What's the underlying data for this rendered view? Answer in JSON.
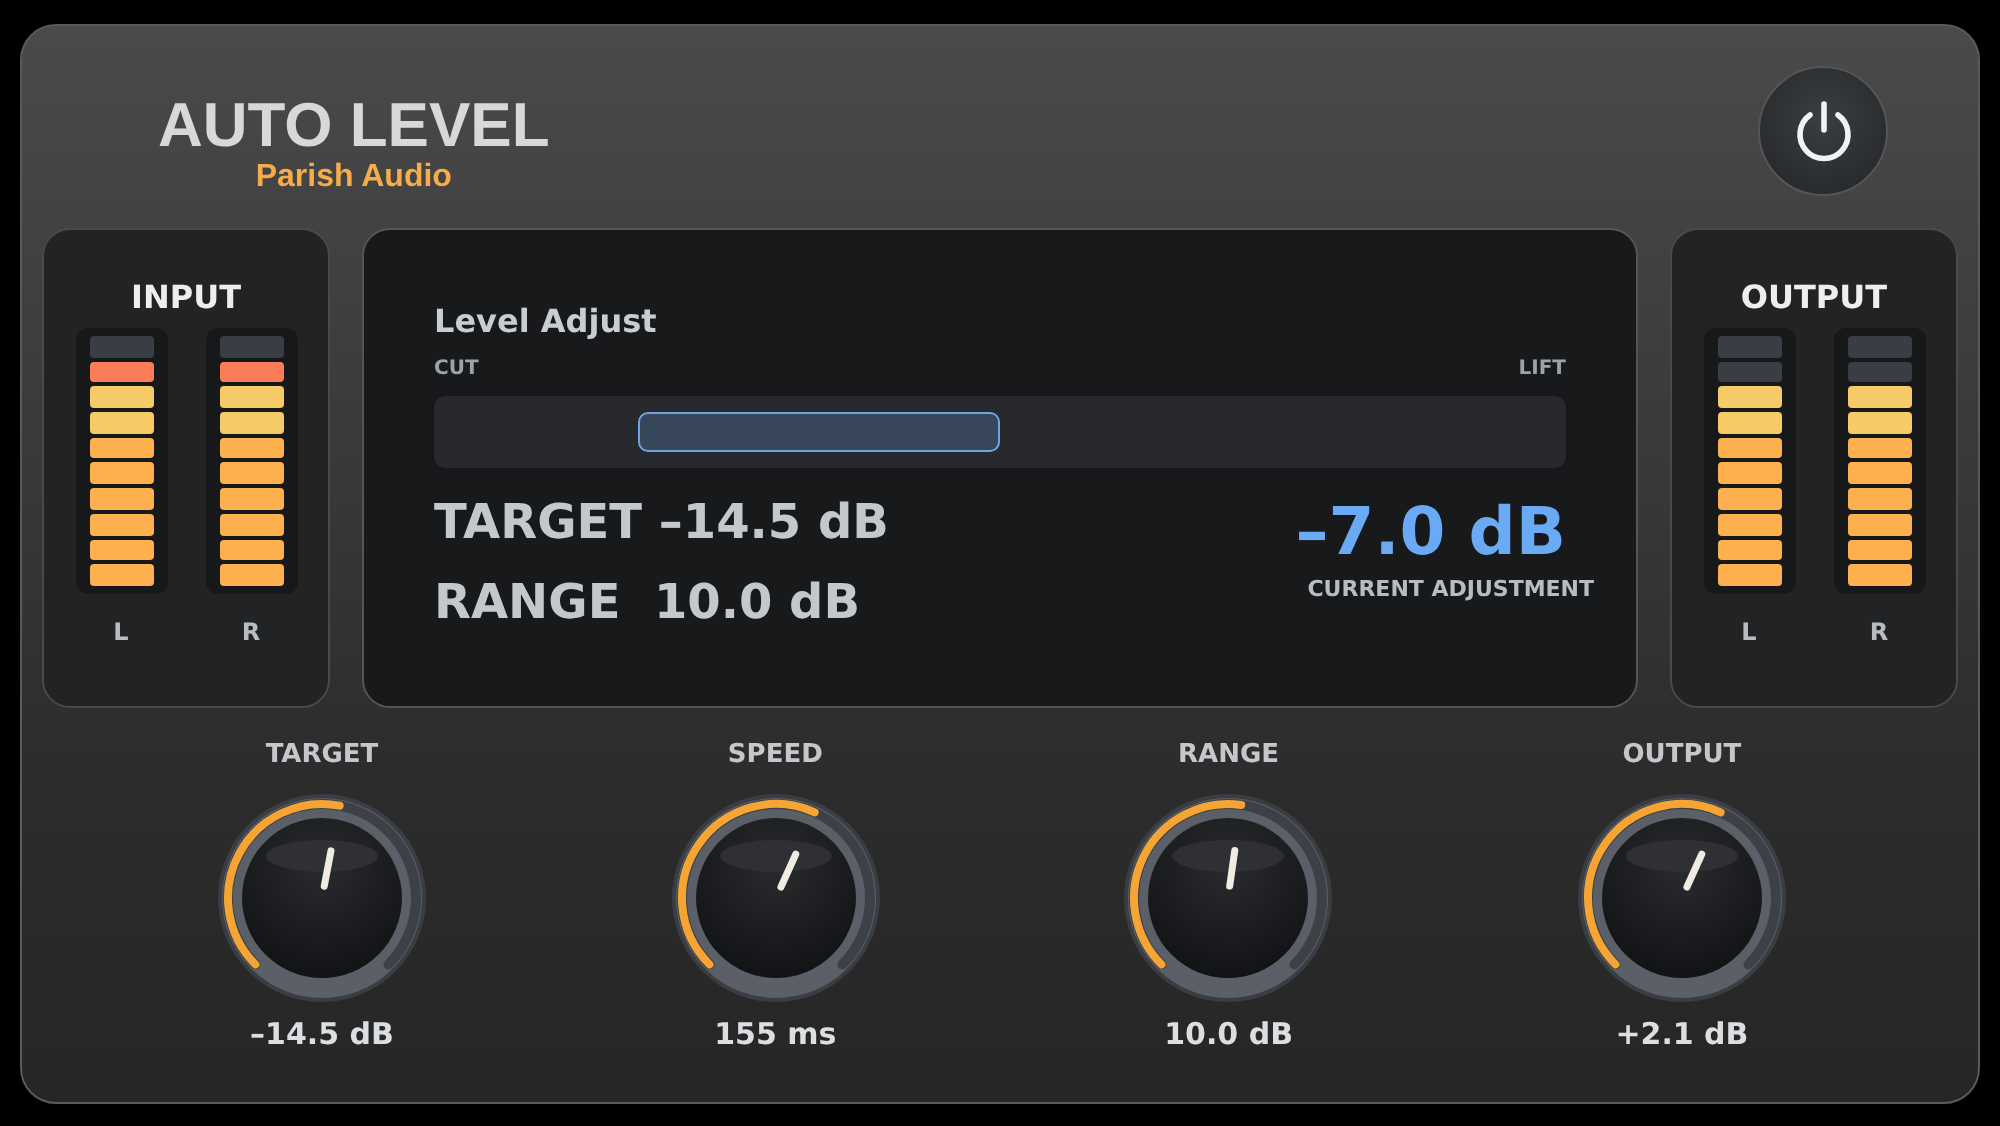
{
  "header": {
    "title": "AUTO LEVEL",
    "brand": "Parish Audio",
    "power": {
      "on": true
    }
  },
  "input_meter": {
    "title": "INPUT",
    "channels": [
      {
        "name": "L",
        "level": 0.9
      },
      {
        "name": "R",
        "level": 0.9
      }
    ]
  },
  "display": {
    "title": "Level Adjust",
    "left_label": "CUT",
    "right_label": "LIFT",
    "adjust": {
      "level": 0.32
    },
    "target_label": "TARGET",
    "target_value": "–14.5 dB",
    "range_label": "RANGE",
    "range_value": "10.0 dB",
    "current_value": "–7.0 dB",
    "current_label": "CURRENT ADJUSTMENT"
  },
  "output_meter": {
    "title": "OUTPUT",
    "channels": [
      {
        "name": "L",
        "level": 0.8
      },
      {
        "name": "R",
        "level": 0.8
      }
    ]
  },
  "knobs": [
    {
      "label": "TARGET",
      "value": "–14.5 dB"
    },
    {
      "label": "SPEED",
      "value": "155 ms"
    },
    {
      "label": "RANGE",
      "value": "10.0 dB"
    },
    {
      "label": "OUTPUT",
      "value": "+2.1 dB"
    }
  ]
}
